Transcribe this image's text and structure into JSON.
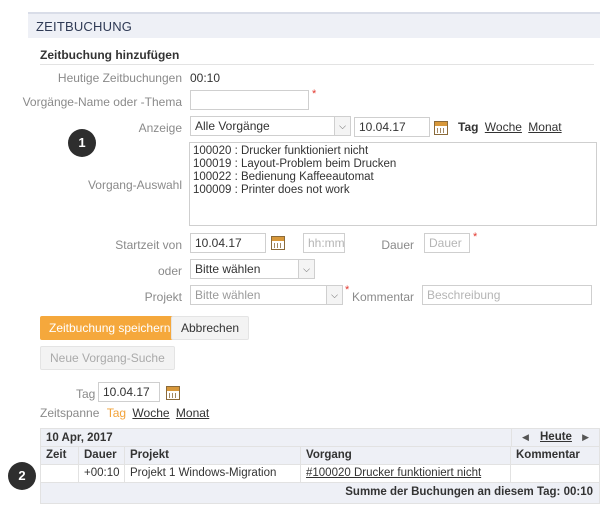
{
  "page": {
    "title": "ZEITBUCHUNG",
    "section_title": "Zeitbuchung hinzufügen"
  },
  "form": {
    "todays_bookings_label": "Heutige Zeitbuchungen",
    "todays_bookings_value": "00:10",
    "process_name_label": "Vorgänge-Name oder -Thema",
    "process_name_value": "",
    "display_label": "Anzeige",
    "display_value": "Alle Vorgänge",
    "display_date": "10.04.17",
    "period_tabs": [
      "Tag",
      "Woche",
      "Monat"
    ],
    "selection_label": "Vorgang-Auswahl",
    "selection_items": [
      "100020 : Drucker funktioniert nicht",
      "100019 : Layout-Problem beim Drucken",
      "100022 : Bedienung Kaffeeautomat",
      "100009 : Printer does not work"
    ],
    "start_label": "Startzeit von",
    "start_date": "10.04.17",
    "start_time_placeholder": "hh:mm",
    "duration_label": "Dauer",
    "duration_placeholder": "Dauer",
    "or_label": "oder",
    "or_value": "Bitte wählen",
    "project_label": "Projekt",
    "project_value": "Bitte wählen",
    "comment_label": "Kommentar",
    "comment_placeholder": "Beschreibung",
    "required_mark": "*"
  },
  "buttons": {
    "save": "Zeitbuchung speichern",
    "cancel": "Abbrechen",
    "new_search": "Neue Vorgang-Suche"
  },
  "badges": [
    "1",
    "2"
  ],
  "filter": {
    "day_label": "Tag",
    "day_value": "10.04.17",
    "span_label": "Zeitspanne",
    "span_tabs": [
      "Tag",
      "Woche",
      "Monat"
    ],
    "span_active": "Tag"
  },
  "table": {
    "date": "10 Apr, 2017",
    "nav_today": "Heute",
    "headers": [
      "Zeit",
      "Dauer",
      "Projekt",
      "Vorgang",
      "Kommentar"
    ],
    "rows": [
      {
        "zeit": "",
        "dauer": "+00:10",
        "projekt": "Projekt 1 Windows-Migration",
        "vorgang": "#100020 Drucker funktioniert nicht",
        "kommentar": ""
      }
    ],
    "footer": "Summe der Buchungen an diesem Tag: 00:10"
  },
  "colors": {
    "accent": "#f5a83c",
    "header_bg": "#eef0f6",
    "required": "#e2382f"
  }
}
